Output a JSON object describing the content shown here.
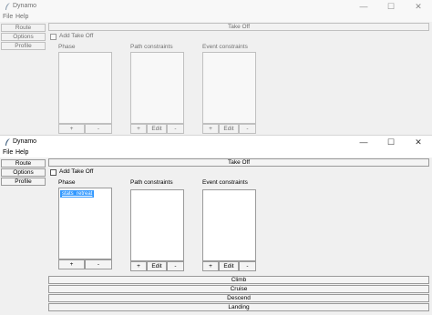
{
  "window_back": {
    "title": "Dynamo",
    "menu": [
      "File",
      "Help"
    ],
    "caption": {
      "minimize": "—",
      "maximize": "☐",
      "close": "✕"
    },
    "sidebar": [
      "Route",
      "Options",
      "Profile"
    ],
    "section_bar": "Take Off",
    "checkbox_label": "Add Take Off",
    "phase_title": "Phase",
    "path_title": "Path constraints",
    "event_title": "Event constraints",
    "add": "+",
    "remove": "-",
    "edit": "Edit"
  },
  "window_front": {
    "title": "Dynamo",
    "menu": [
      "File",
      "Help"
    ],
    "caption": {
      "minimize": "—",
      "maximize": "☐",
      "close": "✕"
    },
    "sidebar": [
      "Route",
      "Options",
      "Profile"
    ],
    "section_bar": "Take Off",
    "checkbox_label": "Add Take Off",
    "phase_title": "Phase",
    "path_title": "Path constraints",
    "event_title": "Event constraints",
    "phase_items": [
      "stats_retreat"
    ],
    "add": "+",
    "remove": "-",
    "edit": "Edit",
    "sections": [
      "Climb",
      "Cruise",
      "Descend",
      "Landing"
    ]
  }
}
